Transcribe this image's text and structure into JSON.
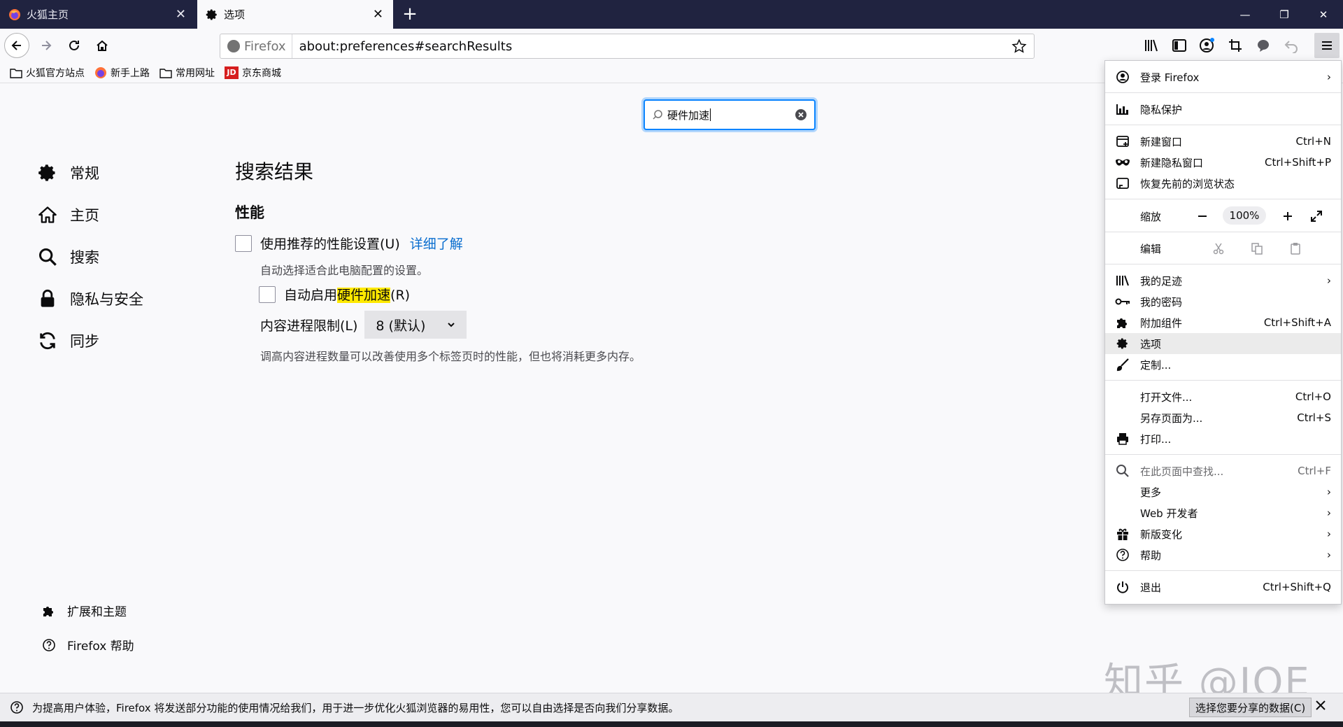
{
  "tabs": [
    {
      "label": "火狐主页",
      "icon": "firefox-icon"
    },
    {
      "label": "选项",
      "icon": "gear-icon"
    }
  ],
  "window_controls": [
    "minimize",
    "restore",
    "close"
  ],
  "urlbar": {
    "identity": "Firefox",
    "url": "about:preferences#searchResults"
  },
  "bookmarks": [
    {
      "label": "火狐官方站点",
      "icon": "folder-icon"
    },
    {
      "label": "新手上路",
      "icon": "firefox-icon"
    },
    {
      "label": "常用网址",
      "icon": "folder-icon"
    },
    {
      "label": "京东商城",
      "icon": "jd-icon",
      "icon_text": "JD"
    }
  ],
  "prefs_search": {
    "value": "硬件加速"
  },
  "sidebar": {
    "items": [
      {
        "label": "常规",
        "icon": "gear-icon"
      },
      {
        "label": "主页",
        "icon": "home-icon"
      },
      {
        "label": "搜索",
        "icon": "search-icon"
      },
      {
        "label": "隐私与安全",
        "icon": "lock-icon"
      },
      {
        "label": "同步",
        "icon": "sync-icon"
      }
    ],
    "bottom": [
      {
        "label": "扩展和主题",
        "icon": "puzzle-icon"
      },
      {
        "label": "Firefox 帮助",
        "icon": "help-icon"
      }
    ]
  },
  "main": {
    "heading": "搜索结果",
    "section": "性能",
    "recommended": {
      "label": "使用推荐的性能设置(U)",
      "link": "详细了解",
      "checked": false
    },
    "recommended_desc": "自动选择适合此电脑配置的设置。",
    "hwaccel": {
      "prefix": "自动启用",
      "highlight": "硬件加速",
      "suffix": "(R)",
      "checked": false
    },
    "process_limit": {
      "label": "内容进程限制(L)",
      "value": "8 (默认)"
    },
    "process_desc": "调高内容进程数量可以改善使用多个标签页时的性能，但也将消耗更多内存。"
  },
  "menu": {
    "signin": "登录 Firefox",
    "privacy": "隐私保护",
    "new_window": {
      "label": "新建窗口",
      "key": "Ctrl+N"
    },
    "new_private": {
      "label": "新建隐私窗口",
      "key": "Ctrl+Shift+P"
    },
    "restore": "恢复先前的浏览状态",
    "zoom": {
      "label": "缩放",
      "value": "100%"
    },
    "edit": "编辑",
    "library": "我的足迹",
    "logins": "我的密码",
    "addons": {
      "label": "附加组件",
      "key": "Ctrl+Shift+A"
    },
    "options": "选项",
    "customize": "定制...",
    "open_file": {
      "label": "打开文件...",
      "key": "Ctrl+O"
    },
    "save_as": {
      "label": "另存页面为...",
      "key": "Ctrl+S"
    },
    "print": "打印...",
    "find": {
      "label": "在此页面中查找...",
      "key": "Ctrl+F"
    },
    "more": "更多",
    "webdev": "Web 开发者",
    "whatsnew": "新版变化",
    "help": "帮助",
    "quit": {
      "label": "退出",
      "key": "Ctrl+Shift+Q"
    }
  },
  "notification": {
    "text": "为提高用户体验，Firefox 将发送部分功能的使用情况给我们，用于进一步优化火狐浏览器的易用性，您可以自由选择是否向我们分享数据。",
    "button": "选择您要分享的数据(C)"
  },
  "watermark": "知乎 @JOE",
  "colors": {
    "tabbar": "#202340",
    "accent": "#0a84ff",
    "highlight": "#ffe900",
    "link": "#0a6ecf"
  }
}
